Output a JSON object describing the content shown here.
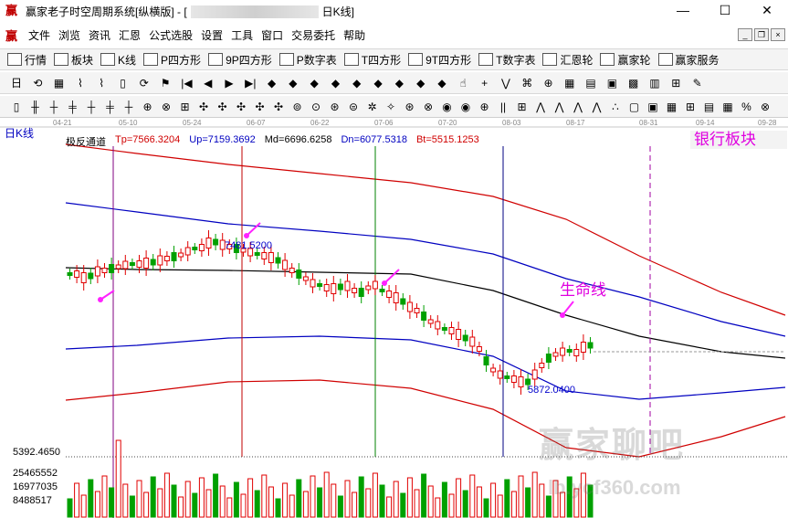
{
  "window": {
    "title_prefix": "赢家老子时空周期系统[纵横版] - [",
    "title_suffix": "日K线]",
    "controls": {
      "minimize": "—",
      "maximize": "☐",
      "close": "✕"
    }
  },
  "menu": [
    "文件",
    "浏览",
    "资讯",
    "汇恩",
    "公式选股",
    "设置",
    "工具",
    "窗口",
    "交易委托",
    "帮助"
  ],
  "mdi_controls": {
    "minimize": "_",
    "restore": "❐",
    "close": "×"
  },
  "toolbar1": [
    {
      "label": "行情",
      "icon": "quote-icon"
    },
    {
      "label": "板块",
      "icon": "sector-icon"
    },
    {
      "label": "K线",
      "icon": "kline-icon"
    },
    {
      "label": "P四方形",
      "icon": "p-square-icon"
    },
    {
      "label": "9P四方形",
      "icon": "9p-square-icon"
    },
    {
      "label": "P数字表",
      "icon": "p-number-table-icon"
    },
    {
      "label": "T四方形",
      "icon": "t-square-icon"
    },
    {
      "label": "9T四方形",
      "icon": "9t-square-icon"
    },
    {
      "label": "T数字表",
      "icon": "t-number-table-icon"
    },
    {
      "label": "汇恩轮",
      "icon": "huien-wheel-icon"
    },
    {
      "label": "赢家轮",
      "icon": "winner-wheel-icon"
    },
    {
      "label": "赢家服务",
      "icon": "winner-service-icon"
    }
  ],
  "toolbar2_icons": [
    "日",
    "⟲",
    "▦",
    "⌇",
    "⌇",
    "▯",
    "⟳",
    "⚑",
    "|◀",
    "◀",
    "▶",
    "▶|",
    "◆",
    "◆",
    "◆",
    "◆",
    "◆",
    "◆",
    "◆",
    "◆",
    "◆",
    "☝",
    "+",
    "⋁",
    "⌘",
    "⊕",
    "▦",
    "▤",
    "▣",
    "▩",
    "▥",
    "⊞",
    "✎"
  ],
  "toolbar3_icons": [
    "▯",
    "╫",
    "┼",
    "╪",
    "┼",
    "╪",
    "┼",
    "⊕",
    "⊗",
    "⊞",
    "✣",
    "✣",
    "✣",
    "✣",
    "✣",
    "⊚",
    "⊙",
    "⊛",
    "⊜",
    "✲",
    "✧",
    "⊛",
    "⊗",
    "◉",
    "◉",
    "⊕",
    "||",
    "⊞",
    "⋀",
    "⋀",
    "⋀",
    "⋀",
    "∴",
    "▢",
    "▣",
    "▦",
    "⊞",
    "▤",
    "▦",
    "%",
    "⊗"
  ],
  "dates": [
    "04-21",
    "05-10",
    "05-24",
    "06-07",
    "06-22",
    "07-06",
    "07-20",
    "08-03",
    "08-17",
    "08-31",
    "09-14",
    "09-28"
  ],
  "period_label": "日K线",
  "board_title": "银行板块",
  "indicator": {
    "name": "极反通道",
    "tp": "Tp=7566.3204",
    "up": "Up=7159.3692",
    "md": "Md=6696.6258",
    "dn": "Dn=6077.5318",
    "bt": "Bt=5515.1253"
  },
  "annotations": {
    "high": "7481.5200",
    "low": "5872.0400",
    "life_line": "生命线"
  },
  "axis_values": {
    "price_low": "5392.4650",
    "vol_1": "25465552",
    "vol_2": "16977035",
    "vol_3": "8488517"
  },
  "watermark": {
    "main": "赢家聊吧",
    "url": "lb.ycf360.com"
  },
  "colors": {
    "up": "#e00000",
    "down": "#00a000",
    "upper_band": "#d00000",
    "mid_band": "#0000c0",
    "middle_line": "#000000",
    "marker": "#ff22ff"
  }
}
